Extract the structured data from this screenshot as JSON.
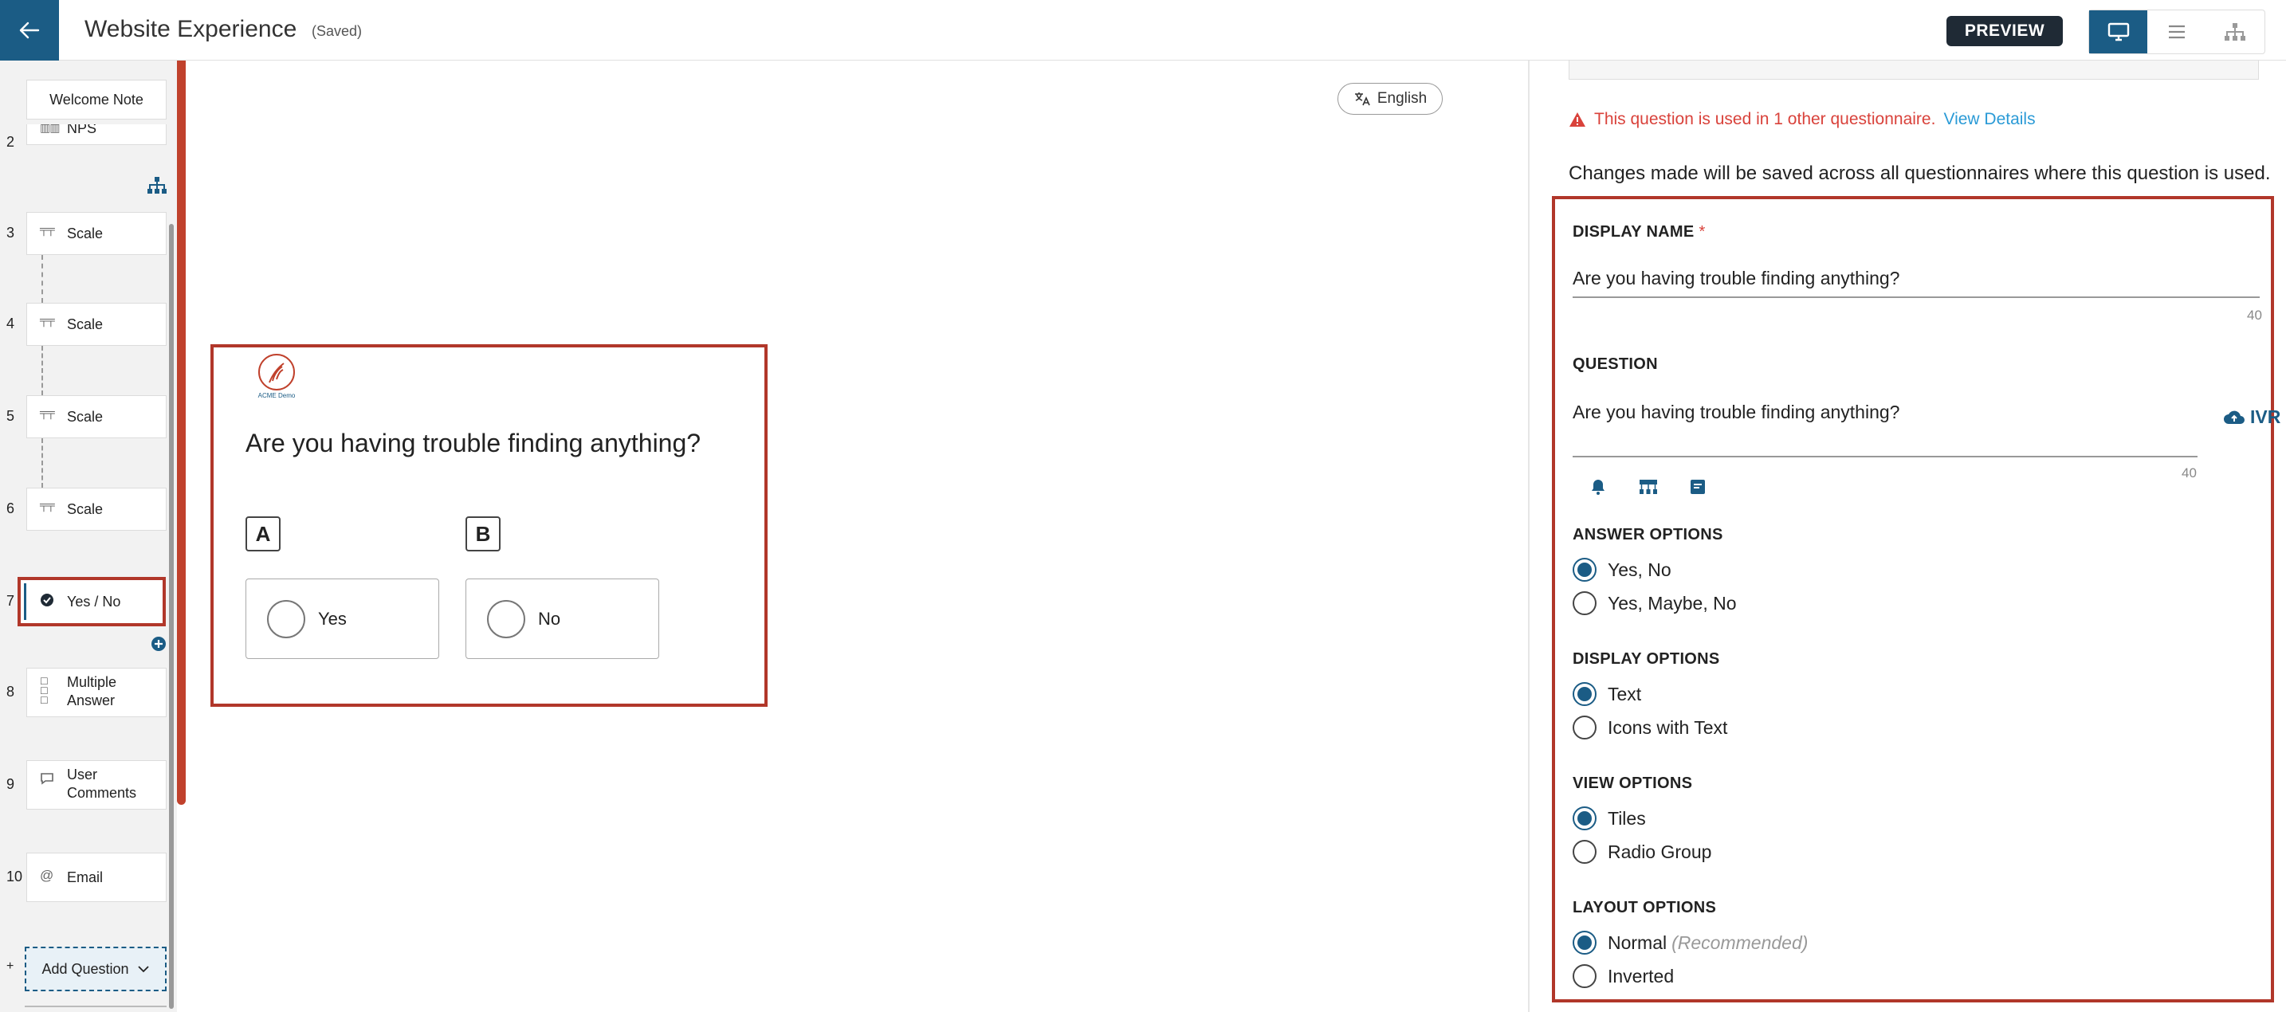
{
  "app": {
    "title": "Website Experience",
    "saved_status": "(Saved)",
    "preview_label": "PREVIEW"
  },
  "view_buttons": [
    "desktop-icon",
    "list-icon",
    "hierarchy-icon"
  ],
  "sidebar": {
    "welcome_note": "Welcome Note",
    "partial_item": {
      "num": "2",
      "label": "NPS"
    },
    "items": [
      {
        "num": "3",
        "label": "Scale",
        "icon": "scale-icon"
      },
      {
        "num": "4",
        "label": "Scale",
        "icon": "scale-icon"
      },
      {
        "num": "5",
        "label": "Scale",
        "icon": "scale-icon"
      },
      {
        "num": "6",
        "label": "Scale",
        "icon": "scale-icon"
      },
      {
        "num": "7",
        "label": "Yes / No",
        "icon": "check-circle-icon"
      },
      {
        "num": "8",
        "label": "Multiple Answer",
        "icon": "checklist-icon"
      },
      {
        "num": "9",
        "label": "User Comments",
        "icon": "comment-icon"
      },
      {
        "num": "10",
        "label": "Email",
        "icon": "at-icon"
      }
    ],
    "add_question_label": "Add Question",
    "add_prefix": "+"
  },
  "preview": {
    "language": "English",
    "logo_text": "ACME Demo",
    "question": "Are you having trouble finding anything?",
    "options": [
      {
        "letter": "A",
        "label": "Yes"
      },
      {
        "letter": "B",
        "label": "No"
      }
    ]
  },
  "panel": {
    "warning_text": "This question is used in 1 other questionnaire.",
    "warning_link": "View Details",
    "changes_note": "Changes made will be saved across all questionnaires where this question is used.",
    "display_name_label": "DISPLAY NAME",
    "required_mark": "*",
    "display_name_value": "Are you having trouble finding anything?",
    "display_name_count": "40",
    "question_label": "QUESTION",
    "question_value": "Are you having trouble finding anything?",
    "question_count": "40",
    "ivr_label": "IVR",
    "answer_options_label": "ANSWER OPTIONS",
    "answer_options": [
      "Yes, No",
      "Yes, Maybe, No"
    ],
    "answer_selected": 0,
    "display_options_label": "DISPLAY OPTIONS",
    "display_options": [
      "Text",
      "Icons with Text"
    ],
    "display_selected": 0,
    "view_options_label": "VIEW OPTIONS",
    "view_options": [
      "Tiles",
      "Radio Group"
    ],
    "view_selected": 0,
    "layout_options_label": "LAYOUT OPTIONS",
    "layout_options": [
      "Normal",
      "Inverted"
    ],
    "layout_recommended": "(Recommended)",
    "layout_selected": 0
  },
  "colors": {
    "brand": "#1b5c85",
    "highlight": "#b1372a",
    "warning": "#d9423b",
    "link": "#2a9ad6"
  }
}
